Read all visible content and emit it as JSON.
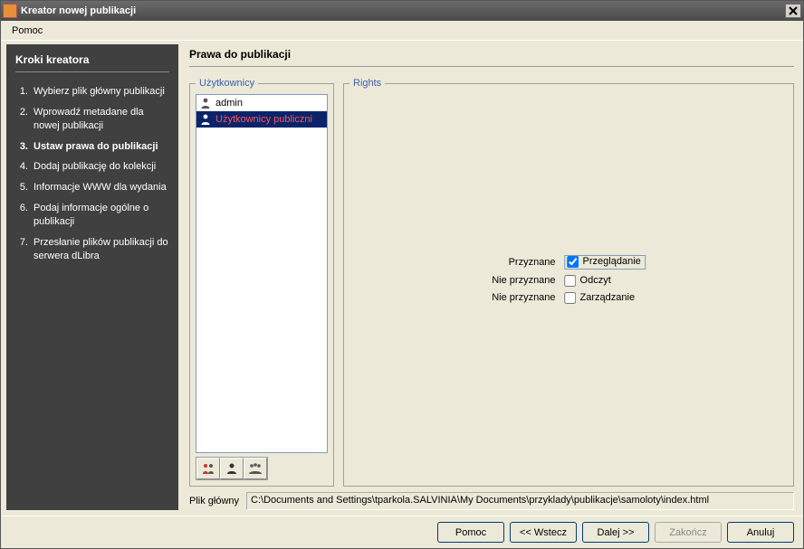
{
  "window": {
    "title": "Kreator nowej publikacji"
  },
  "menubar": {
    "help": "Pomoc"
  },
  "sidebar": {
    "title": "Kroki kreatora",
    "steps": [
      {
        "num": "1.",
        "label": "Wybierz plik główny publikacji"
      },
      {
        "num": "2.",
        "label": "Wprowadź metadane dla nowej publikacji"
      },
      {
        "num": "3.",
        "label": "Ustaw prawa do publikacji"
      },
      {
        "num": "4.",
        "label": "Dodaj publikację do kolekcji"
      },
      {
        "num": "5.",
        "label": "Informacje WWW dla wydania"
      },
      {
        "num": "6.",
        "label": "Podaj informacje ogólne o publikacji"
      },
      {
        "num": "7.",
        "label": "Przesłanie plików publikacji do serwera dLibra"
      }
    ],
    "active_index": 2
  },
  "main": {
    "title": "Prawa do publikacji",
    "users_legend": "Użytkownicy",
    "rights_legend": "Rights",
    "users": [
      {
        "label": "admin",
        "special": false,
        "selected": false
      },
      {
        "label": "Użytkownicy publiczni",
        "special": true,
        "selected": true
      }
    ],
    "toolbar_icons": [
      "user-group-icon",
      "user-single-icon",
      "user-all-icon"
    ],
    "rights_rows": [
      {
        "status": "Przyznane",
        "label": "Przeglądanie",
        "checked": true,
        "framed": true
      },
      {
        "status": "Nie przyznane",
        "label": "Odczyt",
        "checked": false,
        "framed": false
      },
      {
        "status": "Nie przyznane",
        "label": "Zarządzanie",
        "checked": false,
        "framed": false
      }
    ],
    "main_file_label": "Plik główny",
    "main_file_value": "C:\\Documents and Settings\\tparkola.SALVINIA\\My Documents\\przyklady\\publikacje\\samoloty\\index.html"
  },
  "buttons": {
    "help": "Pomoc",
    "back": "<< Wstecz",
    "next": "Dalej >>",
    "finish": "Zakończ",
    "cancel": "Anuluj"
  }
}
